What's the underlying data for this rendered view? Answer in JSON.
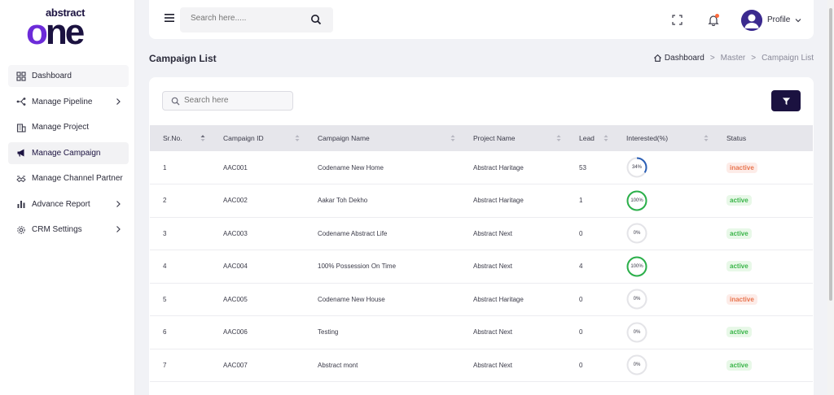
{
  "brand": {
    "small": "abstract",
    "big": "one"
  },
  "sidebar": {
    "items": [
      {
        "label": "Dashboard",
        "icon": "dashboard-icon",
        "has_children": false,
        "active": false
      },
      {
        "label": "Manage Pipeline",
        "icon": "pipeline-icon",
        "has_children": true,
        "active": false
      },
      {
        "label": "Manage Project",
        "icon": "building-icon",
        "has_children": false,
        "active": false
      },
      {
        "label": "Manage Campaign",
        "icon": "megaphone-icon",
        "has_children": false,
        "active": true
      },
      {
        "label": "Manage Channel Partner",
        "icon": "partner-icon",
        "has_children": false,
        "active": false
      },
      {
        "label": "Advance Report",
        "icon": "bar-chart-icon",
        "has_children": true,
        "active": false
      },
      {
        "label": "CRM Settings",
        "icon": "gear-icon",
        "has_children": true,
        "active": false
      }
    ]
  },
  "header": {
    "search_placeholder": "Search here.....",
    "profile_label": "Profile"
  },
  "page": {
    "title": "Campaign List",
    "breadcrumb": [
      "Dashboard",
      "Master",
      "Campaign List"
    ]
  },
  "table": {
    "search_placeholder": "Search here",
    "columns": [
      "Sr.No.",
      "Campaign ID",
      "Campaign Name",
      "Project Name",
      "Lead",
      "Interested(%)",
      "Status"
    ],
    "rows": [
      {
        "sr": "1",
        "id": "AAC001",
        "name": "Codename New Home",
        "project": "Abstract Haritage",
        "lead": "53",
        "interested": 34,
        "interested_label": "34%",
        "status": "inactive"
      },
      {
        "sr": "2",
        "id": "AAC002",
        "name": "Aakar Toh Dekho",
        "project": "Abstract Haritage",
        "lead": "1",
        "interested": 100,
        "interested_label": "100%",
        "status": "active"
      },
      {
        "sr": "3",
        "id": "AAC003",
        "name": "Codename Abstract Life",
        "project": "Abstract Next",
        "lead": "0",
        "interested": 0,
        "interested_label": "0%",
        "status": "active"
      },
      {
        "sr": "4",
        "id": "AAC004",
        "name": "100% Possession On Time",
        "project": "Abstract Next",
        "lead": "4",
        "interested": 100,
        "interested_label": "100%",
        "status": "active"
      },
      {
        "sr": "5",
        "id": "AAC005",
        "name": "Codename New House",
        "project": "Abstract Haritage",
        "lead": "0",
        "interested": 0,
        "interested_label": "0%",
        "status": "inactive"
      },
      {
        "sr": "6",
        "id": "AAC006",
        "name": "Testing",
        "project": "Abstract Next",
        "lead": "0",
        "interested": 0,
        "interested_label": "0%",
        "status": "active"
      },
      {
        "sr": "7",
        "id": "AAC007",
        "name": "Abstract mont",
        "project": "Abstract Next",
        "lead": "0",
        "interested": 0,
        "interested_label": "0%",
        "status": "active"
      }
    ]
  },
  "colors": {
    "brand_dark": "#1b1240",
    "brand_purple": "#6c2bd9",
    "ring_full": "#2bb04a",
    "ring_partial": "#2b5fb5",
    "ring_track": "#e4e4e8",
    "active_text": "#3bb54a",
    "inactive_text": "#e8754f"
  }
}
